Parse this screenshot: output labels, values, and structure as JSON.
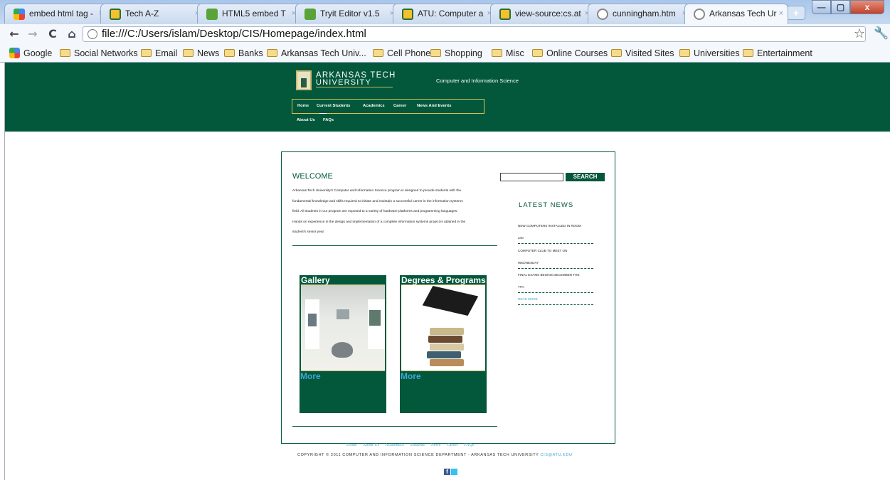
{
  "browser": {
    "tabs": [
      {
        "title": "embed html tag -",
        "icon": "google-icon"
      },
      {
        "title": "Tech A-Z",
        "icon": "atu-icon"
      },
      {
        "title": "HTML5 embed T",
        "icon": "tryit-icon"
      },
      {
        "title": "Tryit Editor v1.5",
        "icon": "tryit-icon"
      },
      {
        "title": "ATU: Computer a",
        "icon": "atu-icon"
      },
      {
        "title": "view-source:cs.at",
        "icon": "atu-icon"
      },
      {
        "title": "cunningham.htm",
        "icon": "globe-icon"
      },
      {
        "title": "Arkansas Tech Ur",
        "icon": "globe-icon",
        "active": true
      }
    ],
    "tab_close_glyph": "×",
    "new_tab_glyph": "+",
    "window_buttons": {
      "minimize": "—",
      "maximize": "▢",
      "close": "x"
    },
    "nav_glyphs": {
      "back": "←",
      "forward": "→",
      "reload": "C",
      "home": "⌂",
      "star": "☆",
      "wrench": "🔧"
    },
    "address": "file:///C:/Users/islam/Desktop/CIS/Homepage/index.html",
    "bookmarks": [
      "Google",
      "Social Networks",
      "Email",
      "News",
      "Banks",
      "Arkansas Tech Univ...",
      "Cell Phone",
      "Shopping",
      "Misc",
      "Online Courses",
      "Visited Sites",
      "Universities",
      "Entertainment"
    ]
  },
  "header": {
    "logo_line1": "ARKANSAS TECH",
    "logo_line2": "UNIVERSITY",
    "department": "Computer and Information Science",
    "nav": [
      "Home",
      "Current Students",
      "Academics",
      "Career",
      "News And Events"
    ],
    "nav_row2": [
      "About Us",
      "FAQs"
    ]
  },
  "main": {
    "welcome_title": "WELCOME",
    "intro_lines": [
      "Arkansas Tech University's Computer and Information Science program is designed to provide students with the",
      "fundamental knowledge and skills required to initiate and maintain a successful career in the information systems",
      "field. All students in our program are exposed to a variety of hardware platforms and programming languages.",
      "Hands on experience in the design and implementation of a complete information systems project is attained in the",
      "student's senior year."
    ],
    "cards": [
      {
        "title": "Gallery",
        "more": "More"
      },
      {
        "title": "Degrees & Programs",
        "more": "More"
      }
    ]
  },
  "sidebar": {
    "search_button": "SEARCH",
    "news_title": "LATEST NEWS",
    "news_lines": [
      "NEW COMPUTERS INSTALLED IN ROOM",
      "240",
      "COMPUTER CLUB TO MEET ON",
      "WEDNESDAY",
      "FINAL EXAMS BEGINS DECEMBER THE",
      "7TH"
    ],
    "read_more": "READ MORE"
  },
  "footer": {
    "links": [
      "Home",
      "About Us",
      "Academics",
      "Students",
      "News",
      "Career",
      "FAQs"
    ],
    "copyright": "COPYRIGHT © 2011 COMPUTER AND INFORMATION SCIENCE DEPARTMENT - ARKANSAS TECH UNIVERSITY",
    "email": "CIS@ATU.EDU",
    "facebook_glyph": "f"
  },
  "colors": {
    "brand_green": "#03573a",
    "gold": "#d9c55a",
    "link_blue": "#3fa7d6"
  }
}
